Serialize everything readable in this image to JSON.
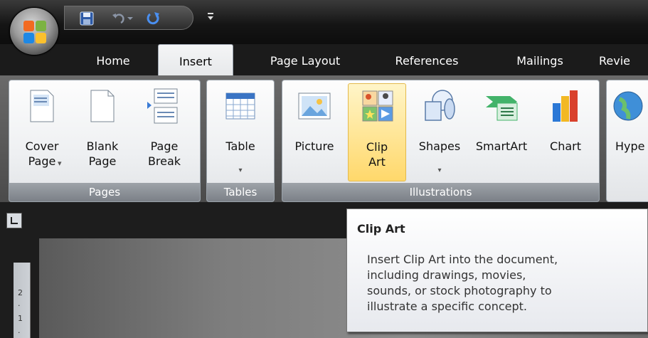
{
  "tabs": [
    "Home",
    "Insert",
    "Page Layout",
    "References",
    "Mailings",
    "Revie"
  ],
  "active_tab": "Insert",
  "groups": {
    "pages": {
      "label": "Pages",
      "buttons": [
        {
          "label": "Cover\nPage",
          "has_arrow": true
        },
        {
          "label": "Blank\nPage"
        },
        {
          "label": "Page\nBreak"
        }
      ]
    },
    "tables": {
      "label": "Tables",
      "buttons": [
        {
          "label": "Table",
          "arrow": "▾"
        }
      ]
    },
    "illustrations": {
      "label": "Illustrations",
      "buttons": [
        {
          "label": "Picture"
        },
        {
          "label": "Clip\nArt"
        },
        {
          "label": "Shapes",
          "arrow": "▾"
        },
        {
          "label": "SmartArt"
        },
        {
          "label": "Chart"
        }
      ]
    },
    "links": {
      "buttons": [
        {
          "label": "Hype"
        }
      ]
    }
  },
  "cover_page_arrow": "▾",
  "tooltip": {
    "title": "Clip Art",
    "body": "Insert Clip Art into the document,\nincluding drawings, movies,\nsounds, or stock photography to\nillustrate a specific concept."
  },
  "ruler_marks": [
    "2",
    "·",
    "1",
    "·"
  ],
  "colors": {
    "highlight": "#ffd86b",
    "group_label_bg": "#8a8f95",
    "tooltip_bg": "#ffffff"
  }
}
